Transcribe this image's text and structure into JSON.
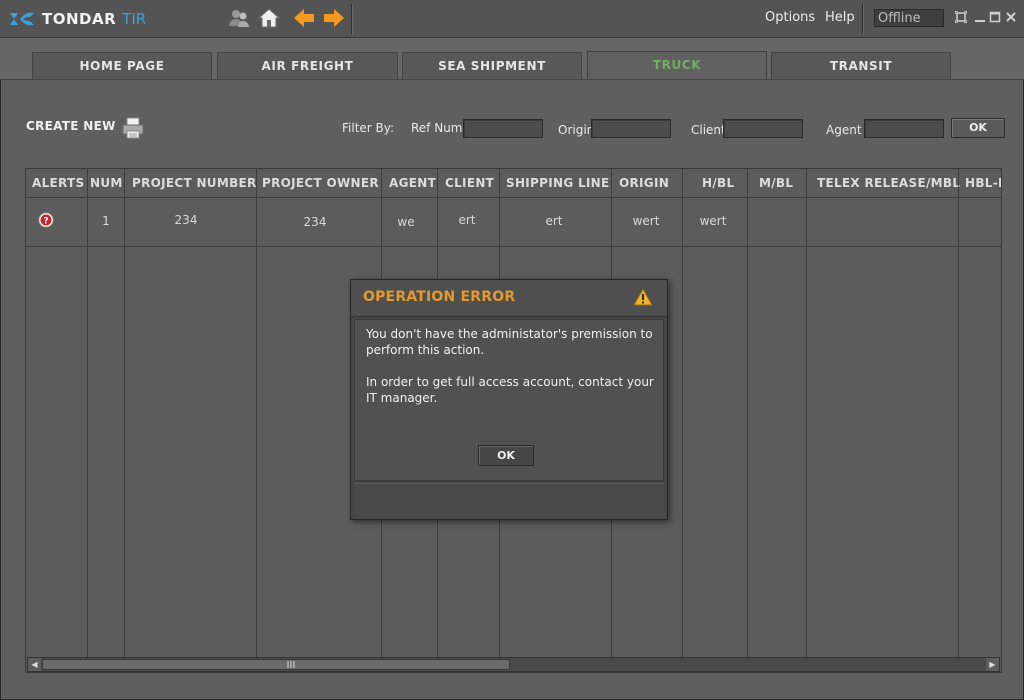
{
  "app": {
    "logo_bold": "TONDAR",
    "logo_accent": "TIR",
    "menu": {
      "options": "Options",
      "help": "Help"
    },
    "status": "Offline"
  },
  "tabs": [
    {
      "label": "HOME PAGE"
    },
    {
      "label": "AIR FREIGHT"
    },
    {
      "label": "SEA SHIPMENT"
    },
    {
      "label": "TRUCK"
    },
    {
      "label": "TRANSIT"
    }
  ],
  "active_tab": "TRUCK",
  "toolbar": {
    "create_new": "CREATE NEW",
    "filter_by": "Filter By:",
    "ref_num_label": "Ref Num",
    "origin_label": "Origin",
    "client_label": "Client",
    "agent_label": "Agent",
    "ok_label": "OK"
  },
  "table": {
    "columns": [
      "ALERTS",
      "NUM",
      "PROJECT NUMBER",
      "PROJECT OWNER",
      "AGENT",
      "CLIENT",
      "SHIPPING LINE",
      "ORIGIN",
      "H/BL",
      "M/BL",
      "TELEX RELEASE/MBL",
      "HBL-F"
    ],
    "rows": [
      {
        "num": "1",
        "project_number": "234",
        "project_owner": "234",
        "agent": "we",
        "client": "ert",
        "shipping_line": "ert",
        "origin": "wert",
        "hbl": "wert",
        "mbl": "",
        "telex": ""
      }
    ]
  },
  "dialog": {
    "title": "OPERATION ERROR",
    "message1": "You don't have the administator's premission to perform this action.",
    "message2": "In order to get full access account, contact your IT manager.",
    "ok_label": "OK"
  },
  "colors": {
    "background": "#5f5f5f",
    "active_tab_text": "#6fae5f",
    "dialog_title": "#e29a2e",
    "logo_accent": "#3aa0d8",
    "nav_arrows": "#f39a1e"
  },
  "icons": [
    "logo-icon",
    "users-icon",
    "home-icon",
    "back-arrow-icon",
    "forward-arrow-icon",
    "printer-icon",
    "help-alert-icon",
    "warning-icon",
    "restore-icon",
    "minimize-icon",
    "maximize-icon",
    "close-icon"
  ]
}
